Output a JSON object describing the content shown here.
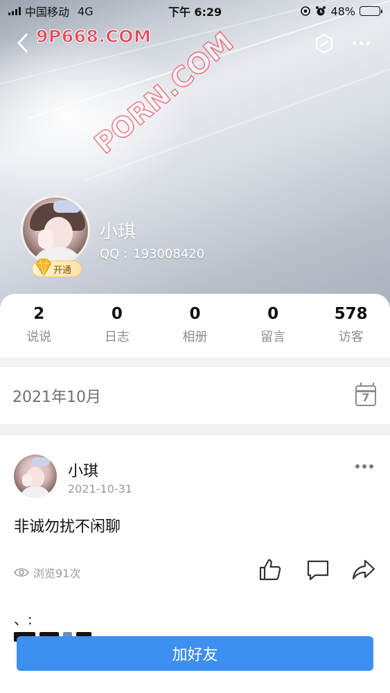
{
  "status_bar": {
    "carrier": "中国移动",
    "network": "4G",
    "time": "下午 6:29",
    "battery_percent": "48%",
    "battery_level": 0.48
  },
  "header": {
    "watermark_top": "9P668.COM",
    "watermark_diagonal": "PORN.COM",
    "back_icon": "chevron-left-icon",
    "hex_icon": "hexagon-icon",
    "more_icon": "more-horizontal-icon"
  },
  "profile": {
    "name": "小琪",
    "qq_label": "QQ :",
    "qq_number": "193008420",
    "vip_label": "开通"
  },
  "stats": [
    {
      "value": "2",
      "label": "说说"
    },
    {
      "value": "0",
      "label": "日志"
    },
    {
      "value": "0",
      "label": "相册"
    },
    {
      "value": "0",
      "label": "留言"
    },
    {
      "value": "578",
      "label": "访客"
    }
  ],
  "timeline": {
    "month": "2021年10月",
    "calendar_day": "7"
  },
  "post": {
    "author": "小琪",
    "date": "2021-10-31",
    "body": "非诚勿扰不闲聊",
    "views": "浏览91次",
    "extra_line": "、:"
  },
  "actions": {
    "add_friend": "加好友"
  },
  "colors": {
    "accent": "#3d8ff0",
    "watermark": "#e8495b",
    "vip_gold": "#ffe3a5"
  }
}
